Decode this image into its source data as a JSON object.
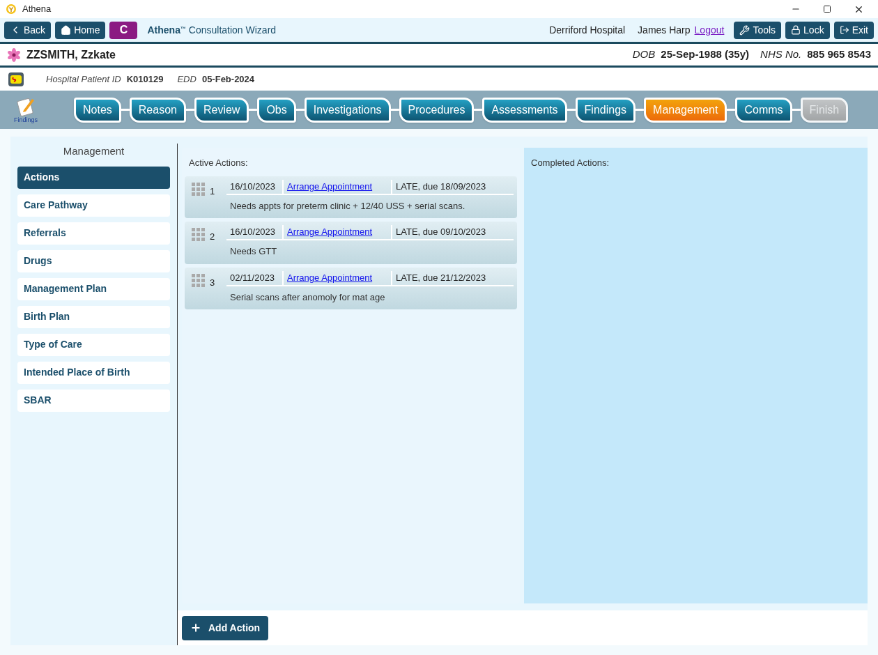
{
  "window": {
    "title": "Athena"
  },
  "toolbar": {
    "back": "Back",
    "home": "Home",
    "badge": "C",
    "app_name": "Athena",
    "app_tm": "™",
    "app_subtitle": "Consultation Wizard",
    "hospital": "Derriford Hospital",
    "user": "James Harp",
    "logout": "Logout",
    "tools": "Tools",
    "lock": "Lock",
    "exit": "Exit"
  },
  "patient": {
    "name": "ZZSMITH, Zzkate",
    "dob_label": "DOB",
    "dob": "25-Sep-1988 (35y)",
    "nhs_label": "NHS No.",
    "nhs": "885 965 8543",
    "hospital_id_label": "Hospital Patient ID",
    "hospital_id": "K010129",
    "edd_label": "EDD",
    "edd": "05-Feb-2024"
  },
  "wizard": {
    "icon_label": "Findings",
    "steps": [
      {
        "label": "Notes",
        "selected": false,
        "disabled": false
      },
      {
        "label": "Reason",
        "selected": false,
        "disabled": false
      },
      {
        "label": "Review",
        "selected": false,
        "disabled": false
      },
      {
        "label": "Obs",
        "selected": false,
        "disabled": false
      },
      {
        "label": "Investigations",
        "selected": false,
        "disabled": false
      },
      {
        "label": "Procedures",
        "selected": false,
        "disabled": false
      },
      {
        "label": "Assessments",
        "selected": false,
        "disabled": false
      },
      {
        "label": "Findings",
        "selected": false,
        "disabled": false
      },
      {
        "label": "Management",
        "selected": true,
        "disabled": false
      },
      {
        "label": "Comms",
        "selected": false,
        "disabled": false
      },
      {
        "label": "Finish",
        "selected": false,
        "disabled": true
      }
    ]
  },
  "sidebar": {
    "title": "Management",
    "items": [
      {
        "label": "Actions",
        "selected": true
      },
      {
        "label": "Care Pathway",
        "selected": false
      },
      {
        "label": "Referrals",
        "selected": false
      },
      {
        "label": "Drugs",
        "selected": false
      },
      {
        "label": "Management Plan",
        "selected": false
      },
      {
        "label": "Birth Plan",
        "selected": false
      },
      {
        "label": "Type of Care",
        "selected": false
      },
      {
        "label": "Intended Place of Birth",
        "selected": false
      },
      {
        "label": "SBAR",
        "selected": false
      }
    ]
  },
  "active_actions": {
    "title": "Active Actions:",
    "rows": [
      {
        "number": "1",
        "date": "16/10/2023",
        "action": "Arrange Appointment",
        "due": "LATE, due 18/09/2023",
        "note": "Needs appts for preterm clinic + 12/40 USS + serial scans."
      },
      {
        "number": "2",
        "date": "16/10/2023",
        "action": "Arrange Appointment",
        "due": "LATE, due 09/10/2023",
        "note": "Needs GTT"
      },
      {
        "number": "3",
        "date": "02/11/2023",
        "action": "Arrange Appointment",
        "due": "LATE, due 21/12/2023",
        "note": "Serial scans after anomoly for mat age"
      }
    ]
  },
  "completed_actions": {
    "title": "Completed Actions:"
  },
  "add_button": "Add Action"
}
